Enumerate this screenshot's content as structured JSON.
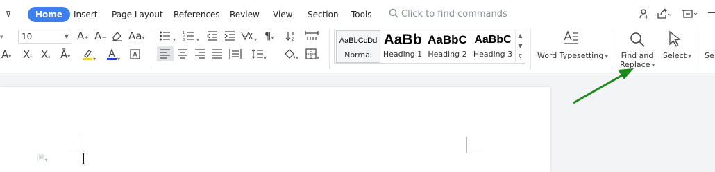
{
  "menu": {
    "tabs": [
      "Home",
      "Insert",
      "Page Layout",
      "References",
      "Review",
      "View",
      "Section",
      "Tools"
    ],
    "active_tab": "Home",
    "search_placeholder": "Click to find commands",
    "accent_color": "#3c7ff0"
  },
  "font": {
    "size": "10"
  },
  "toolbar": {
    "icons": [
      "increase-font-size",
      "decrease-font-size",
      "clear-formatting",
      "change-case",
      "bullets",
      "numbering",
      "decrease-indent",
      "increase-indent",
      "chinese-layout",
      "show-hide-marks",
      "distributed-columns",
      "superscript",
      "subscript",
      "text-effects",
      "highlight",
      "font-color",
      "character-border",
      "align-left",
      "align-center",
      "align-right",
      "justify",
      "distributed",
      "line-spacing",
      "shading",
      "borders"
    ],
    "active_alignment": "align-left",
    "highlight_color": "#f5d13a",
    "font_color": "#1f3fcf"
  },
  "styles": {
    "items": [
      {
        "preview": "AaBbCcDd",
        "name": "Normal"
      },
      {
        "preview": "AaBb",
        "name": "Heading 1"
      },
      {
        "preview": "AaBbC",
        "name": "Heading 2"
      },
      {
        "preview": "AaBbC",
        "name": "Heading 3"
      }
    ],
    "selected": "Normal"
  },
  "commands": {
    "word_typesetting": "Word Typesetting",
    "find_replace_line1": "Find and",
    "find_replace_line2": "Replace",
    "select": "Select",
    "cut_off": "Se"
  },
  "annotation": {
    "arrow_color": "#1e8a1e",
    "target": "Find and Replace"
  }
}
